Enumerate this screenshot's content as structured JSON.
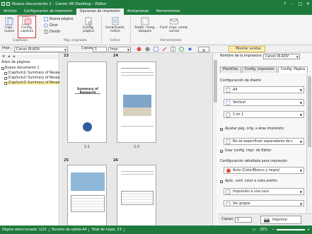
{
  "titlebar": {
    "title": "Nuevo documento 1 - Canon iW Desktop - Editor",
    "help": "?",
    "min": "–",
    "max": "□",
    "close": "✕"
  },
  "menubar": {
    "tabs": [
      "Archivo",
      "Configuración de impresión",
      "Opciones de impresión",
      "Anotaciones",
      "Herramientas"
    ]
  },
  "ribbon": {
    "copy_new": "Copi.\nnuevo",
    "config_chapter": "Config.\ncapítulo",
    "new_page": "Nueva página",
    "rotate": "Girar",
    "split": "Dividir",
    "config_page": "Config.\npágina",
    "index": "Ins/actualiz.\níndice",
    "radio": "Radio: marg.\nbloques",
    "conf_impr": "Conf. impr. comb.\ncorreo",
    "groups": [
      "Capítulos",
      "Pág. originales",
      "Índice",
      "Herramientas"
    ]
  },
  "toolbar": {
    "printer_label": "Impr.:",
    "printer_value": "Canon iR-ADV",
    "copies_label": "Copias:",
    "copies_value": "1",
    "print_btn": "Impr.",
    "show_annot": "Mostrar anotac."
  },
  "left": {
    "header": "Árbol de páginas",
    "root": "Nuevo documento 1",
    "items": [
      "(Capítulo1) Summary of Resea",
      "(Capítulo2) Summary of Resea",
      "(Capítulo3) Summary of Resea"
    ]
  },
  "pages": [
    {
      "num": "23",
      "label": "1-1",
      "title": "Summary of Research"
    },
    {
      "num": "24",
      "label": "2-2",
      "title": ""
    },
    {
      "num": "25",
      "label": "",
      "title": ""
    },
    {
      "num": "26",
      "label": "",
      "title": ""
    }
  ],
  "right": {
    "printer_name_label": "Nombre de la impresora:",
    "printer_name_value": "Canon iR-ADV",
    "tabs": [
      "Plantillas",
      "Config. impresión",
      "Config. Página"
    ],
    "layout_label": "Configuración de diseño",
    "size": "A4",
    "orientation": "Vertical",
    "pages_per_sheet": "1 en 1",
    "fit_label": "Ajustar pág. orig. a área impresión",
    "sep_label": "No se especifican separadores de c",
    "use_config_label": "Usar config. impr. de Editor",
    "detail_label": "Configuración detallada para impresión",
    "color": "Auto (Color/Blanco y negro)",
    "apply_color_label": "Aplic. conf. color a vista prelim.",
    "duplex": "Impresión a una cara",
    "finishing": "Sin grapar",
    "copies_label": "Copias:",
    "copies_value": "1",
    "print_btn": "Imprimir"
  },
  "status": {
    "selected": "Página seleccionada: 1/23",
    "size": "Tamaño de salida:A4",
    "total": "Total de hojas: 23",
    "zoom": "25%"
  },
  "colors": {
    "accent": "#1e7a3c",
    "selected": "#fff2a8"
  }
}
